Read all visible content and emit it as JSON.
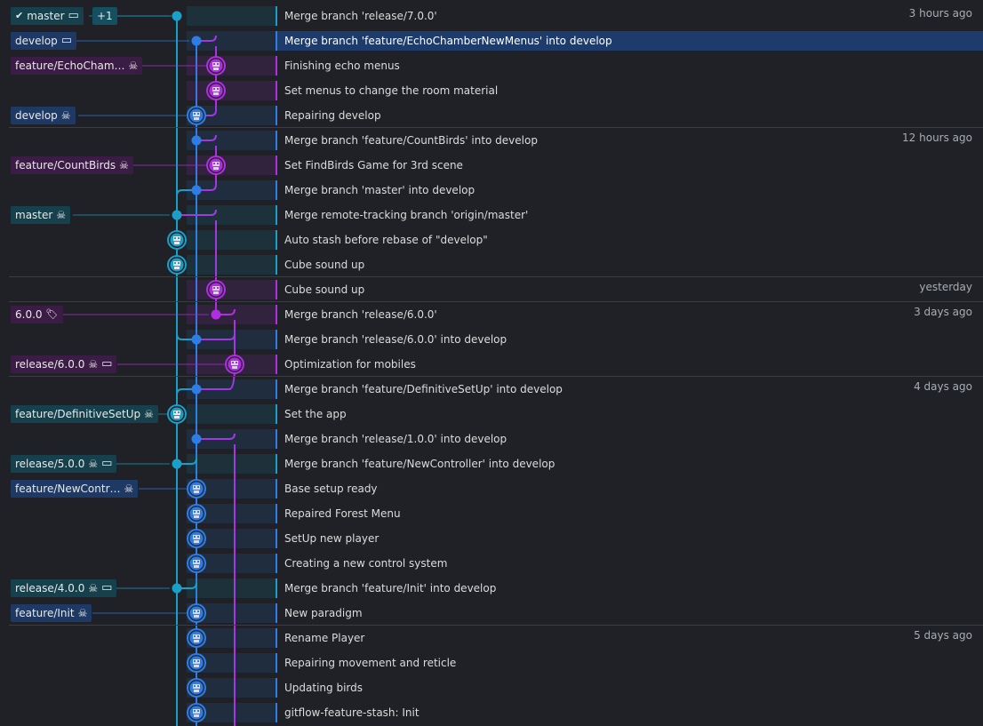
{
  "colors": {
    "background": "#1f2126",
    "selected_row": "#1d3b6b",
    "lane_cyan": "#1aa0c8",
    "lane_blue": "#2f7de6",
    "lane_purple": "#b02fe0",
    "label_blue_bg": "#1e3a64",
    "label_purple_bg": "#3b1c45",
    "label_teal_bg": "#16414c",
    "label_teal_dark_bg": "#145060"
  },
  "dates": [
    "3 hours ago",
    "12 hours ago",
    "yesterday",
    "3 days ago",
    "4 days ago",
    "5 days ago"
  ],
  "rows": [
    {
      "message": "Merge branch 'release/7.0.0'",
      "date": "3 hours ago",
      "divider": false,
      "label": {
        "text": "master",
        "icons": [
          "check-icon",
          "laptop-icon"
        ],
        "extra": "+1",
        "tone": "teal"
      },
      "lane": 0,
      "merge": true
    },
    {
      "message": "Merge branch 'feature/EchoChamberNewMenus' into develop",
      "date": "",
      "divider": false,
      "selected": true,
      "label": {
        "text": "develop",
        "icons": [
          "laptop-icon"
        ],
        "tone": "blue"
      },
      "lane": 1,
      "merge": true
    },
    {
      "message": "Finishing echo menus",
      "date": "",
      "divider": false,
      "label": {
        "text": "feature/EchoCham…",
        "icons": [
          "avatar-icon"
        ],
        "tone": "purple"
      },
      "lane": 2,
      "merge": false
    },
    {
      "message": "Set menus to change the room material",
      "date": "",
      "divider": false,
      "lane": 2,
      "merge": false
    },
    {
      "message": "Repairing develop",
      "date": "",
      "divider": false,
      "label": {
        "text": "develop",
        "icons": [
          "avatar-icon"
        ],
        "tone": "blue"
      },
      "lane": 1,
      "merge": false
    },
    {
      "message": "Merge branch 'feature/CountBirds' into develop",
      "date": "12 hours ago",
      "divider": true,
      "lane": 1,
      "merge": true
    },
    {
      "message": "Set FindBirds Game for 3rd scene",
      "date": "",
      "divider": false,
      "label": {
        "text": "feature/CountBirds",
        "icons": [
          "avatar-icon"
        ],
        "tone": "purple"
      },
      "lane": 2,
      "merge": false
    },
    {
      "message": "Merge branch 'master' into develop",
      "date": "",
      "divider": false,
      "lane": 1,
      "merge": true
    },
    {
      "message": "Merge remote-tracking branch 'origin/master'",
      "date": "",
      "divider": false,
      "label": {
        "text": "master",
        "icons": [
          "avatar-icon"
        ],
        "tone": "teal"
      },
      "lane": 0,
      "merge": true
    },
    {
      "message": "Auto stash before rebase of \"develop\"",
      "date": "",
      "divider": false,
      "lane": 0,
      "merge": false
    },
    {
      "message": "Cube sound up",
      "date": "",
      "divider": false,
      "lane": 0,
      "merge": false
    },
    {
      "message": "Cube sound up",
      "date": "yesterday",
      "divider": true,
      "lane": 2,
      "merge": false
    },
    {
      "message": "Merge branch 'release/6.0.0'",
      "date": "3 days ago",
      "divider": true,
      "label": {
        "text": "6.0.0",
        "icons": [
          "tag-icon"
        ],
        "tone": "purple"
      },
      "lane": 2,
      "merge": true
    },
    {
      "message": "Merge branch 'release/6.0.0' into develop",
      "date": "",
      "divider": false,
      "lane": 1,
      "merge": true
    },
    {
      "message": "Optimization for mobiles",
      "date": "",
      "divider": false,
      "label": {
        "text": "release/6.0.0",
        "icons": [
          "avatar-icon",
          "laptop-icon"
        ],
        "tone": "purple"
      },
      "lane": 3,
      "merge": false
    },
    {
      "message": "Merge branch 'feature/DefinitiveSetUp' into develop",
      "date": "4 days ago",
      "divider": true,
      "lane": 1,
      "merge": true
    },
    {
      "message": "Set the app",
      "date": "",
      "divider": false,
      "label": {
        "text": "feature/DefinitiveSetUp",
        "icons": [
          "avatar-icon"
        ],
        "tone": "teal"
      },
      "lane": 0,
      "merge": false
    },
    {
      "message": "Merge branch 'release/1.0.0' into develop",
      "date": "",
      "divider": false,
      "lane": 1,
      "merge": true
    },
    {
      "message": "Merge branch 'feature/NewController' into develop",
      "date": "",
      "divider": false,
      "label": {
        "text": "release/5.0.0",
        "icons": [
          "avatar-icon",
          "laptop-icon"
        ],
        "tone": "teal"
      },
      "lane": 0,
      "merge": true
    },
    {
      "message": "Base setup ready",
      "date": "",
      "divider": false,
      "label": {
        "text": "feature/NewContr…",
        "icons": [
          "avatar-icon"
        ],
        "tone": "blue"
      },
      "lane": 1,
      "merge": false
    },
    {
      "message": "Repaired Forest Menu",
      "date": "",
      "divider": false,
      "lane": 1,
      "merge": false
    },
    {
      "message": "SetUp new player",
      "date": "",
      "divider": false,
      "lane": 1,
      "merge": false
    },
    {
      "message": "Creating a new control system",
      "date": "",
      "divider": false,
      "lane": 1,
      "merge": false
    },
    {
      "message": "Merge branch 'feature/Init' into develop",
      "date": "",
      "divider": false,
      "label": {
        "text": "release/4.0.0",
        "icons": [
          "avatar-icon",
          "laptop-icon"
        ],
        "tone": "teal"
      },
      "lane": 0,
      "merge": true
    },
    {
      "message": "New paradigm",
      "date": "",
      "divider": false,
      "label": {
        "text": "feature/Init",
        "icons": [
          "avatar-icon"
        ],
        "tone": "blue"
      },
      "lane": 1,
      "merge": false
    },
    {
      "message": "Rename Player",
      "date": "5 days ago",
      "divider": true,
      "lane": 1,
      "merge": false
    },
    {
      "message": "Repairing movement and reticle",
      "date": "",
      "divider": false,
      "lane": 1,
      "merge": false
    },
    {
      "message": "Updating birds",
      "date": "",
      "divider": false,
      "lane": 1,
      "merge": false
    },
    {
      "message": "gitflow-feature-stash: Init",
      "date": "",
      "divider": false,
      "lane": 1,
      "merge": false
    }
  ]
}
